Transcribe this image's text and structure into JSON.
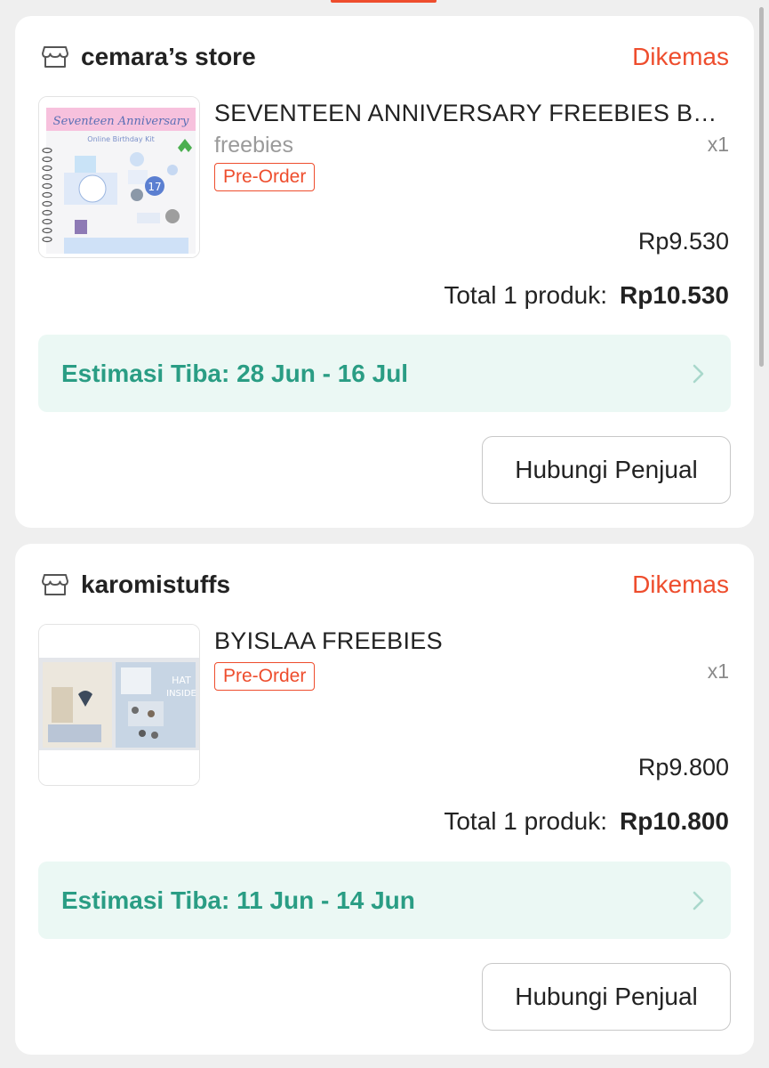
{
  "orders": [
    {
      "store_name": "cemara’s store",
      "status": "Dikemas",
      "product_title": "SEVENTEEN ANNIVERSARY FREEBIES BUNDLE",
      "variant": "freebies",
      "quantity": "x1",
      "badge": "Pre-Order",
      "price": "Rp9.530",
      "total_label": "Total 1 produk:",
      "total_value": "Rp10.530",
      "eta": "Estimasi Tiba: 28 Jun - 16 Jul",
      "contact_button": "Hubungi Penjual",
      "thumbnail_lettering": [
        "Seventeen Anniversary",
        "Online Birthday Kit"
      ]
    },
    {
      "store_name": "karomistuffs",
      "status": "Dikemas",
      "product_title": "BYISLAA FREEBIES",
      "quantity": "x1",
      "badge": "Pre-Order",
      "price": "Rp9.800",
      "total_label": "Total 1 produk:",
      "total_value": "Rp10.800",
      "eta": "Estimasi Tiba: 11 Jun - 14 Jun",
      "contact_button": "Hubungi Penjual",
      "thumbnail_lettering": [
        "HAT",
        "INSIDE"
      ]
    }
  ],
  "icons": {
    "store": "store-icon",
    "chevron": "chevron-right-icon"
  },
  "colors": {
    "accent": "#ee4d2d",
    "eta_text": "#2a9d84",
    "eta_bg": "#ebf8f4"
  }
}
